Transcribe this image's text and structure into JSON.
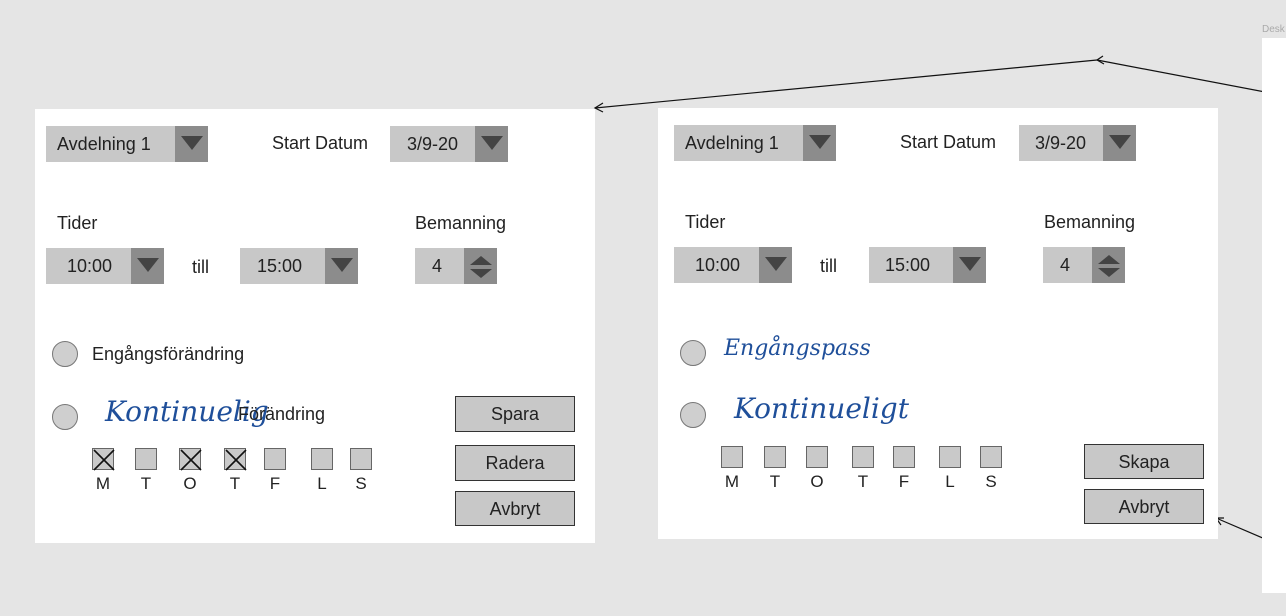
{
  "left_form": {
    "department": "Avdelning 1",
    "start_date_label": "Start Datum",
    "start_date": "3/9-20",
    "times_label": "Tider",
    "time_from": "10:00",
    "till_label": "till",
    "time_to": "15:00",
    "staffing_label": "Bemanning",
    "staffing": "4",
    "option_one": "Engångsförändring",
    "option_two_handwritten": "Kontinuelig",
    "option_two_suffix": "Förändring",
    "days": [
      {
        "label": "M",
        "checked": true
      },
      {
        "label": "T",
        "checked": false
      },
      {
        "label": "O",
        "checked": true
      },
      {
        "label": "T",
        "checked": true
      },
      {
        "label": "F",
        "checked": false
      },
      {
        "label": "L",
        "checked": false
      },
      {
        "label": "S",
        "checked": false
      }
    ],
    "buttons": {
      "save": "Spara",
      "delete": "Radera",
      "cancel": "Avbryt"
    }
  },
  "right_form": {
    "department": "Avdelning 1",
    "start_date_label": "Start Datum",
    "start_date": "3/9-20",
    "times_label": "Tider",
    "time_from": "10:00",
    "till_label": "till",
    "time_to": "15:00",
    "staffing_label": "Bemanning",
    "staffing": "4",
    "option_one_handwritten": "Engångspass",
    "option_two_handwritten": "Kontinueligt",
    "days": [
      {
        "label": "M",
        "checked": false
      },
      {
        "label": "T",
        "checked": false
      },
      {
        "label": "O",
        "checked": false
      },
      {
        "label": "T",
        "checked": false
      },
      {
        "label": "F",
        "checked": false
      },
      {
        "label": "L",
        "checked": false
      },
      {
        "label": "S",
        "checked": false
      }
    ],
    "buttons": {
      "create": "Skapa",
      "cancel": "Avbryt"
    }
  },
  "desktop_label": "Desk"
}
